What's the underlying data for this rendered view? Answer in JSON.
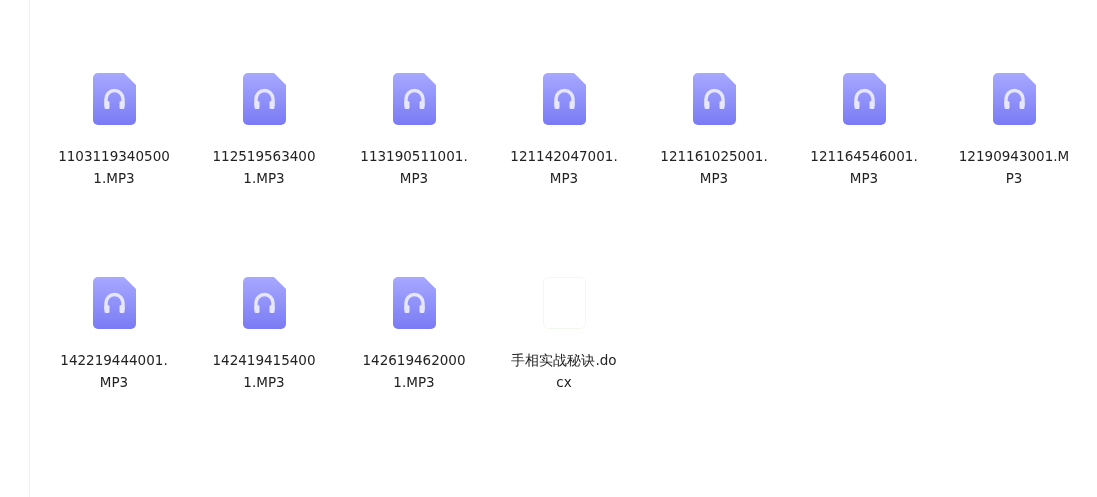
{
  "files": [
    {
      "kind": "audio",
      "name": "11031193405001.MP3"
    },
    {
      "kind": "audio",
      "name": "1125195634001.MP3"
    },
    {
      "kind": "audio",
      "name": "113190511001.MP3"
    },
    {
      "kind": "audio",
      "name": "121142047001.MP3"
    },
    {
      "kind": "audio",
      "name": "121161025001.MP3"
    },
    {
      "kind": "audio",
      "name": "121164546001.MP3"
    },
    {
      "kind": "audio",
      "name": "12190943001.MP3"
    },
    {
      "kind": "audio",
      "name": "142219444001.MP3"
    },
    {
      "kind": "audio",
      "name": "1424194154001.MP3"
    },
    {
      "kind": "audio",
      "name": "1426194620001.MP3"
    },
    {
      "kind": "document",
      "name": "手相实战秘诀.docx"
    }
  ]
}
